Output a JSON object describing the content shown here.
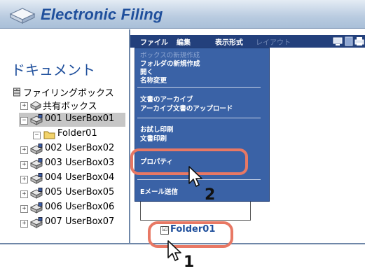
{
  "app": {
    "title": "Electronic Filing"
  },
  "left_panel": {
    "heading": "ドキュメント",
    "tree": {
      "root": "ファイリングボックス",
      "shared": "共有ボックス",
      "boxes": [
        "001 UserBox01",
        "002 UserBox02",
        "003 UserBox03",
        "004 UserBox04",
        "005 UserBox05",
        "006 UserBox06",
        "007 UserBox07"
      ],
      "subfolder": "Folder01",
      "expander_plus": "+",
      "expander_minus": "−"
    }
  },
  "menubar": {
    "items": [
      "ファイル",
      "編集",
      "表示形式",
      "レイアウト"
    ]
  },
  "dropdown": {
    "items": [
      {
        "label": "ボックスの新規作成",
        "enabled": false
      },
      {
        "label": "フォルダの新規作成",
        "enabled": true
      },
      {
        "label": "開く",
        "enabled": true
      },
      {
        "label": "名称変更",
        "enabled": true
      },
      {
        "label": "文書のアーカイブ",
        "enabled": true
      },
      {
        "label": "アーカイブ文書のアップロード",
        "enabled": true
      },
      {
        "label": "お試し印刷",
        "enabled": true
      },
      {
        "label": "文書印刷",
        "enabled": true
      },
      {
        "label": "プロパティ",
        "enabled": true
      },
      {
        "label": "Eメール送信",
        "enabled": true
      }
    ]
  },
  "main": {
    "folder_label": "Folder01",
    "checkbox_mark": "☑"
  },
  "steps": {
    "one": "1",
    "two": "2"
  },
  "colors": {
    "accent": "#1f4f9c",
    "menubar": "#23407c",
    "dropdown": "#3a62a6",
    "callout": "#e87864"
  }
}
